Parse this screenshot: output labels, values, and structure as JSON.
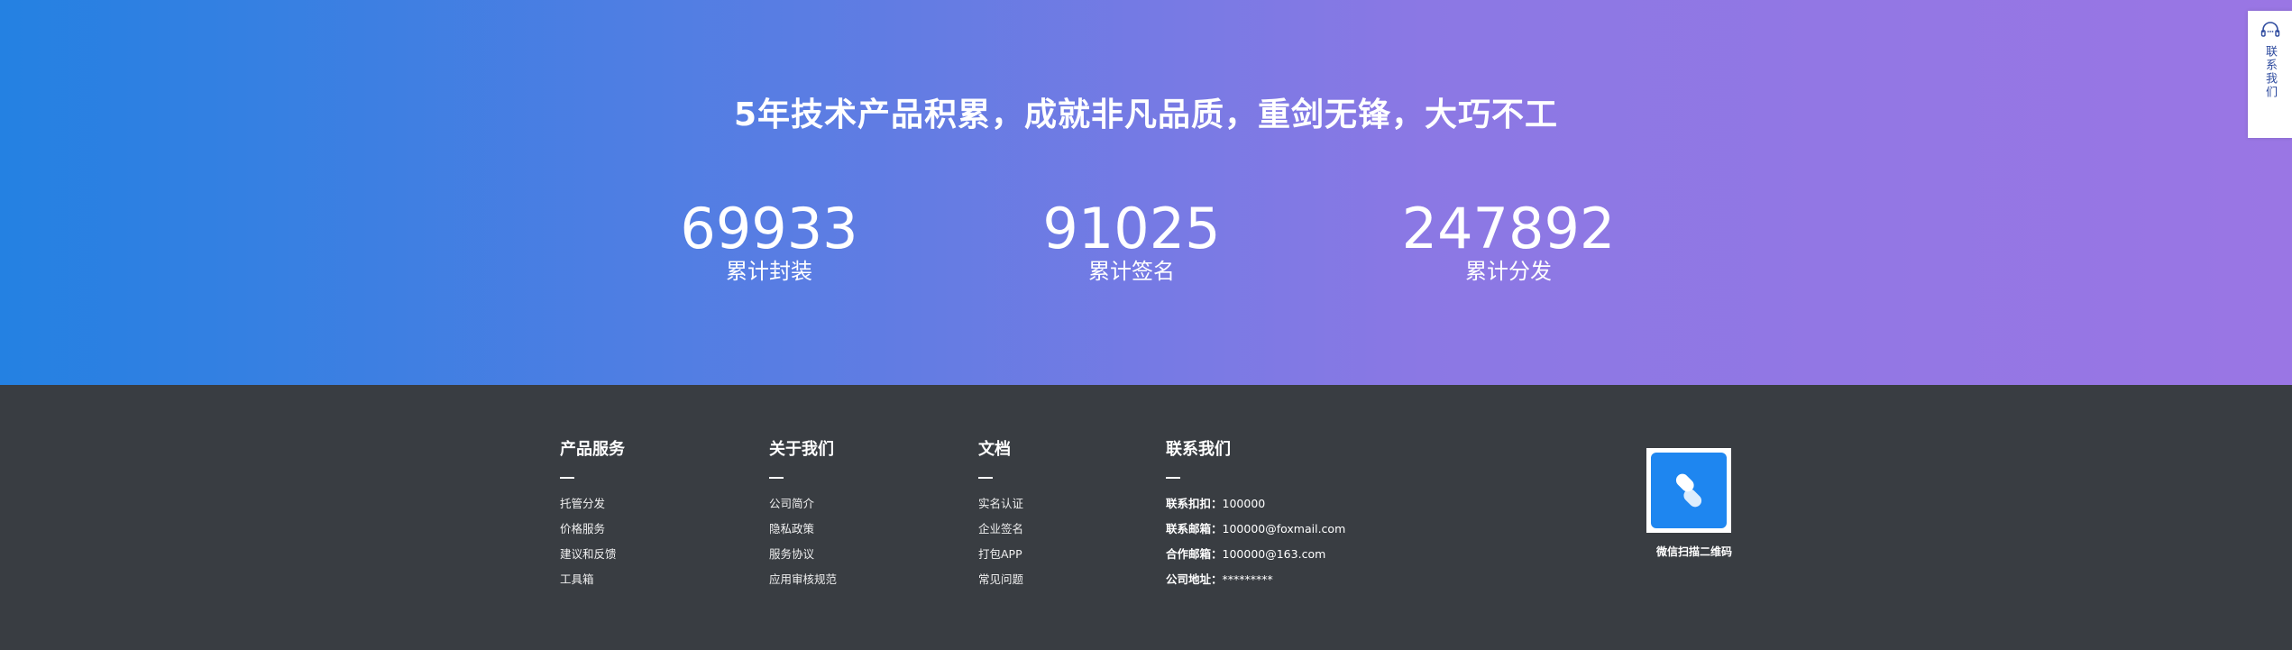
{
  "hero": {
    "title": "5年技术产品积累，成就非凡品质，重剑无锋，大巧不工",
    "stats": [
      {
        "value": "69933",
        "label": "累计封装"
      },
      {
        "value": "91025",
        "label": "累计签名"
      },
      {
        "value": "247892",
        "label": "累计分发"
      }
    ]
  },
  "footer": {
    "product": {
      "title": "产品服务",
      "items": [
        "托管分发",
        "价格服务",
        "建议和反馈",
        "工具箱"
      ]
    },
    "about": {
      "title": "关于我们",
      "items": [
        "公司简介",
        "隐私政策",
        "服务协议",
        "应用审核规范"
      ]
    },
    "docs": {
      "title": "文档",
      "items": [
        "实名认证",
        "企业签名",
        "打包APP",
        "常见问题"
      ]
    },
    "contact": {
      "title": "联系我们",
      "items": [
        {
          "key": "联系扣扣：",
          "value": "100000"
        },
        {
          "key": "联系邮箱：",
          "value": "100000@foxmail.com"
        },
        {
          "key": "合作邮箱：",
          "value": "100000@163.com"
        },
        {
          "key": "公司地址：",
          "value": "*********"
        }
      ]
    },
    "qr_caption": "微信扫描二维码"
  },
  "side_contact": {
    "label": "联系我们",
    "icon": "headset-icon"
  },
  "colors": {
    "gradient_start": "#2481e2",
    "gradient_end": "#9a76e4",
    "footer_bg": "#393d42",
    "qr_blue": "#1e86f0",
    "side_text": "#2d4a9e"
  }
}
